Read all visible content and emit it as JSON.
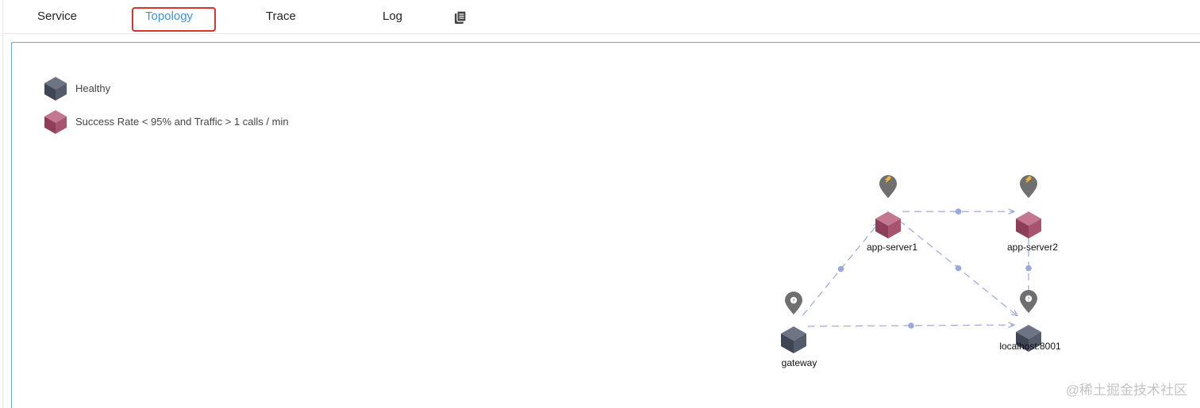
{
  "tabs": [
    {
      "id": "service",
      "label": "Service",
      "active": false
    },
    {
      "id": "topology",
      "label": "Topology",
      "active": true
    },
    {
      "id": "trace",
      "label": "Trace",
      "active": false
    },
    {
      "id": "log",
      "label": "Log",
      "active": false
    }
  ],
  "toolbar": {
    "copy_icon": "copy-icon"
  },
  "legend": [
    {
      "label": "Healthy",
      "status": "healthy",
      "color": "#4a5160"
    },
    {
      "label": "Success Rate < 95% and Traffic > 1 calls / min",
      "status": "degraded",
      "color": "#a24d68"
    }
  ],
  "topology": {
    "nodes": [
      {
        "id": "app-server1",
        "label": "app-server1",
        "status": "degraded",
        "pin_icon": "tomcat-icon"
      },
      {
        "id": "app-server2",
        "label": "app-server2",
        "status": "degraded",
        "pin_icon": "tomcat-icon"
      },
      {
        "id": "gateway",
        "label": "gateway",
        "status": "healthy",
        "pin_icon": "unknown-icon"
      },
      {
        "id": "localhost-8001",
        "label": "localhost:8001",
        "status": "healthy",
        "pin_icon": "unknown-icon"
      }
    ],
    "edges": [
      {
        "from": "app-server1",
        "to": "app-server2"
      },
      {
        "from": "app-server2",
        "to": "localhost-8001"
      },
      {
        "from": "app-server1",
        "to": "localhost-8001"
      },
      {
        "from": "gateway",
        "to": "app-server1"
      },
      {
        "from": "gateway",
        "to": "localhost-8001"
      }
    ],
    "colors": {
      "healthy": "#4a5160",
      "degraded": "#a24d68",
      "edge": "#9aa8dc",
      "pin": "#6f6f6f"
    }
  },
  "watermark": "@稀土掘金技术社区"
}
